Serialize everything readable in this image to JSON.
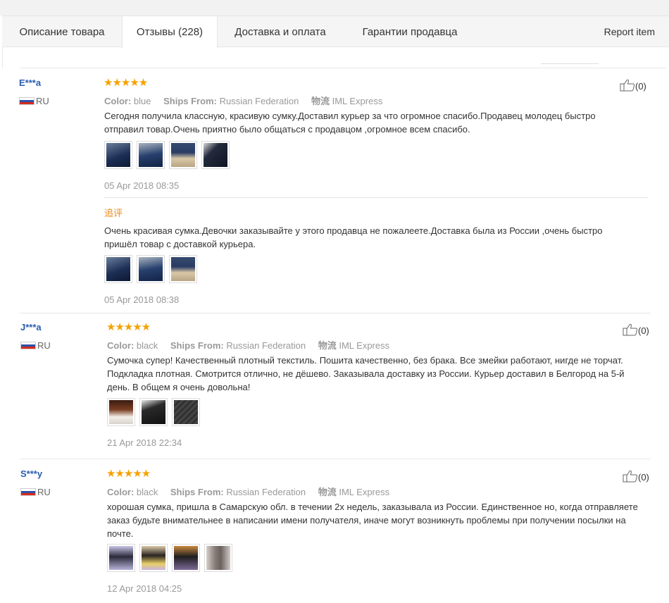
{
  "tabs": [
    {
      "label": "Описание товара"
    },
    {
      "label": "Отзывы (228)"
    },
    {
      "label": "Доставка и оплата"
    },
    {
      "label": "Гарантии продавца"
    }
  ],
  "report_label": "Report item",
  "labels": {
    "color": "Color:",
    "ships_from": "Ships From:",
    "logistics": "物流"
  },
  "stars": "★★★★★",
  "reviews": [
    {
      "user": "E***a",
      "country": "RU",
      "color": "blue",
      "ships_from": "Russian Federation",
      "logistics": "IML Express",
      "text": "Сегодня получила классную, красивую сумку.Доставил курьер за что огромное спасибо.Продавец молодец быстро отправил товар.Очень приятно было общаться с продавцом ,огромное всем спасибо.",
      "date": "05 Apr 2018 08:35",
      "useful": "(0)",
      "followup": {
        "label": "追评",
        "text": "Очень красивая сумка.Девочки заказывайте у этого продавца не пожалеете.Доставка была из России ,очень быстро пришёл товар с доставкой курьера.",
        "date": "05 Apr 2018 08:38"
      }
    },
    {
      "user": "J***a",
      "country": "RU",
      "color": "black",
      "ships_from": "Russian Federation",
      "logistics": "IML Express",
      "text": "Сумочка супер! Качественный плотный текстиль. Пошита качественно, без брака. Все змейки работают, нигде не торчат. Подкладка плотная. Смотрится отлично, не дёшево. Заказывала доставку из России. Курьер доставил в Белгород на 5-й день. В общем я очень довольна!",
      "date": "21 Apr 2018 22:34",
      "useful": "(0)"
    },
    {
      "user": "S***y",
      "country": "RU",
      "color": "black",
      "ships_from": "Russian Federation",
      "logistics": "IML Express",
      "text": "хорошая сумка, пришла в Самарскую обл. в течении 2х недель, заказывала из России. Единственное но, когда отправляете заказ будьте внимательнее в написании имени получателя, иначе могут возникнуть проблемы при получении посылки на почте.",
      "date": "12 Apr 2018 04:25",
      "useful": "(0)"
    }
  ]
}
